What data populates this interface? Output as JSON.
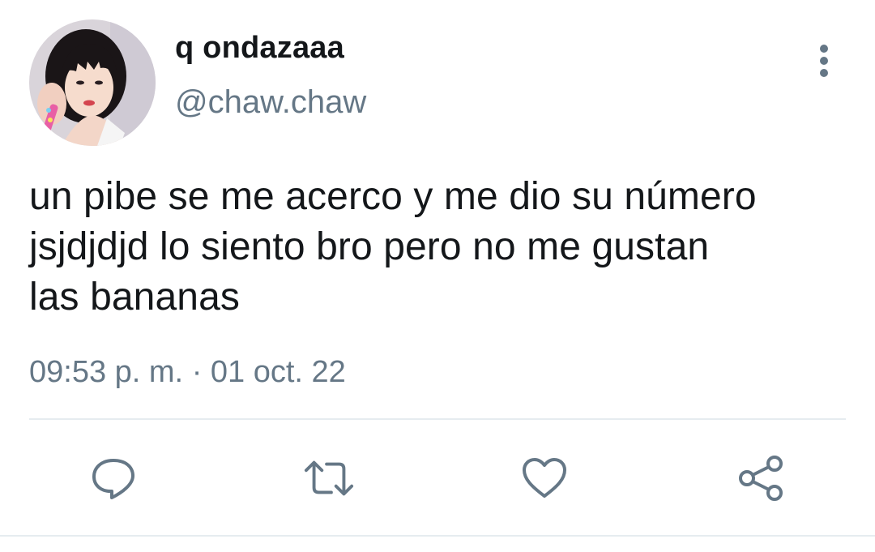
{
  "author": {
    "display_name": "q ondazaaa",
    "handle": "@chaw.chaw",
    "avatar_icon": "profile-photo"
  },
  "tweet": {
    "lines": [
      "un pibe se me acerco y me dio su número",
      "jsjdjdjd lo siento bro pero no me gustan",
      "las bananas"
    ],
    "time": "09:53 p. m.",
    "separator": "·",
    "date": "01 oct. 22"
  },
  "actions": {
    "reply_icon": "reply-icon",
    "retweet_icon": "retweet-icon",
    "like_icon": "heart-icon",
    "share_icon": "share-icon",
    "more_icon": "more-vertical-icon"
  },
  "colors": {
    "text_primary": "#14171a",
    "text_secondary": "#657786",
    "icon": "#657786",
    "divider": "#e6ecf0"
  }
}
